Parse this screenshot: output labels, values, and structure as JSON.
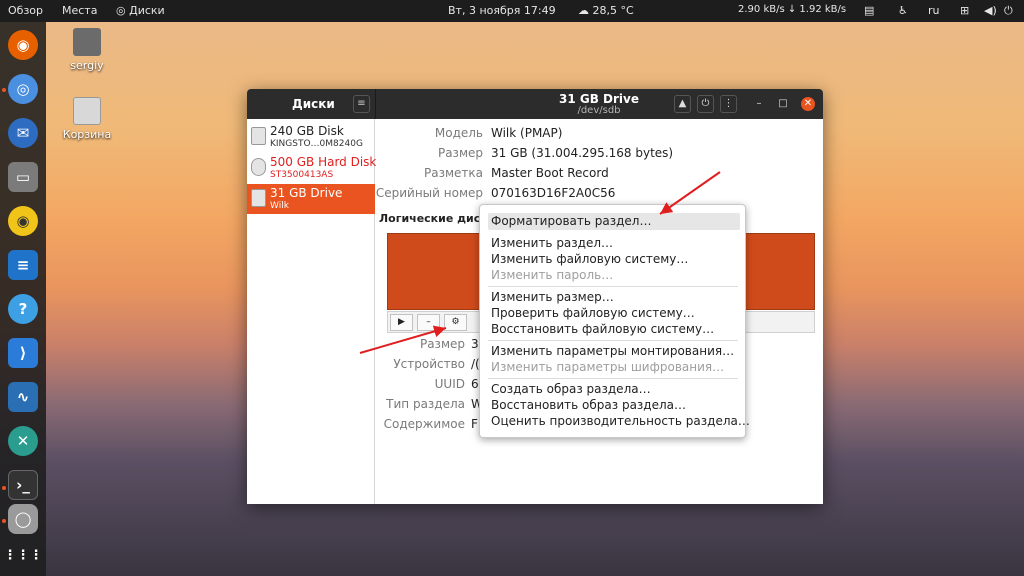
{
  "topbar": {
    "overview": "Обзор",
    "places": "Места",
    "app": "Диски",
    "clock": "Вт, 3 ноября  17:49",
    "weather": "28,5 °C",
    "net_speed": "2.90 kB/s ↓  1.92 kB/s",
    "lang": "ru",
    "icons": [
      "disk-icon",
      "weather-icon",
      "clipboard-icon",
      "accessibility-icon",
      "network-icon",
      "volume-icon",
      "power-icon"
    ]
  },
  "dock": {
    "items": [
      "firefox-icon",
      "chromium-icon",
      "thunderbird-icon",
      "files-icon",
      "rhythmbox-icon",
      "writer-icon",
      "help-icon",
      "vscode-icon",
      "monitor-icon",
      "remmina-icon",
      "terminal-icon",
      "disks-icon",
      "app-grid-icon"
    ]
  },
  "desktop": {
    "home_label": "sergiy",
    "trash_label": "Корзина"
  },
  "window": {
    "left_title": "Диски",
    "title": "31 GB Drive",
    "subtitle": "/dev/sdb",
    "drives": [
      {
        "name": "240 GB Disk",
        "sub": "KINGSTO…0M8240G",
        "state": "normal"
      },
      {
        "name": "500 GB Hard Disk",
        "sub": "ST3500413AS",
        "state": "error"
      },
      {
        "name": "31 GB Drive",
        "sub": "Wilk",
        "state": "selected"
      }
    ],
    "props": [
      {
        "label": "Модель",
        "value": "Wilk (PMAP)"
      },
      {
        "label": "Размер",
        "value": "31 GB (31.004.295.168 bytes)"
      },
      {
        "label": "Разметка",
        "value": "Master Boot Record"
      },
      {
        "label": "Серийный номер",
        "value": "070163D16F2A0C56"
      }
    ],
    "volumes_heading": "Логические дис",
    "volume_toolbar": {
      "play": "▶",
      "minus": "–",
      "gear": "⚙"
    },
    "partition_props": [
      {
        "label": "Размер",
        "value": "3"
      },
      {
        "label": "Устройство",
        "value": "/("
      },
      {
        "label": "UUID",
        "value": "6"
      },
      {
        "label": "Тип раздела",
        "value": "W"
      },
      {
        "label": "Содержимое",
        "value": "F"
      }
    ]
  },
  "menu": {
    "items": [
      {
        "label": "Форматировать раздел…",
        "disabled": false,
        "hover": true
      },
      {
        "label": "Изменить раздел…",
        "disabled": false
      },
      {
        "label": "Изменить файловую систему…",
        "disabled": false
      },
      {
        "label": "Изменить пароль…",
        "disabled": true
      },
      {
        "label": "Изменить размер…",
        "disabled": false
      },
      {
        "label": "Проверить файловую систему…",
        "disabled": false
      },
      {
        "label": "Восстановить файловую систему…",
        "disabled": false
      },
      {
        "label": "Изменить параметры монтирования…",
        "disabled": false
      },
      {
        "label": "Изменить параметры шифрования…",
        "disabled": true
      },
      {
        "label": "Создать образ раздела…",
        "disabled": false
      },
      {
        "label": "Восстановить образ раздела…",
        "disabled": false
      },
      {
        "label": "Оценить производительность раздела…",
        "disabled": false
      }
    ]
  },
  "colors": {
    "accent": "#e95420",
    "error": "#e02020",
    "titlebar": "#2c2c2c"
  }
}
